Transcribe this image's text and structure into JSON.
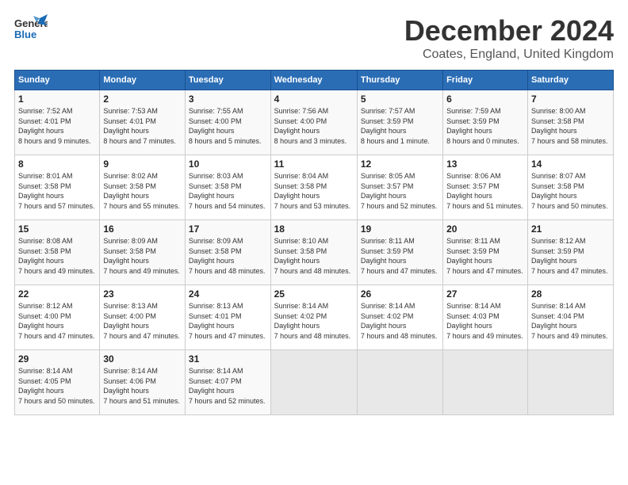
{
  "header": {
    "logo_general": "General",
    "logo_blue": "Blue",
    "month_title": "December 2024",
    "location": "Coates, England, United Kingdom"
  },
  "weekdays": [
    "Sunday",
    "Monday",
    "Tuesday",
    "Wednesday",
    "Thursday",
    "Friday",
    "Saturday"
  ],
  "weeks": [
    [
      {
        "day": "1",
        "sunrise": "7:52 AM",
        "sunset": "4:01 PM",
        "daylight": "8 hours and 9 minutes."
      },
      {
        "day": "2",
        "sunrise": "7:53 AM",
        "sunset": "4:01 PM",
        "daylight": "8 hours and 7 minutes."
      },
      {
        "day": "3",
        "sunrise": "7:55 AM",
        "sunset": "4:00 PM",
        "daylight": "8 hours and 5 minutes."
      },
      {
        "day": "4",
        "sunrise": "7:56 AM",
        "sunset": "4:00 PM",
        "daylight": "8 hours and 3 minutes."
      },
      {
        "day": "5",
        "sunrise": "7:57 AM",
        "sunset": "3:59 PM",
        "daylight": "8 hours and 1 minute."
      },
      {
        "day": "6",
        "sunrise": "7:59 AM",
        "sunset": "3:59 PM",
        "daylight": "8 hours and 0 minutes."
      },
      {
        "day": "7",
        "sunrise": "8:00 AM",
        "sunset": "3:58 PM",
        "daylight": "7 hours and 58 minutes."
      }
    ],
    [
      {
        "day": "8",
        "sunrise": "8:01 AM",
        "sunset": "3:58 PM",
        "daylight": "7 hours and 57 minutes."
      },
      {
        "day": "9",
        "sunrise": "8:02 AM",
        "sunset": "3:58 PM",
        "daylight": "7 hours and 55 minutes."
      },
      {
        "day": "10",
        "sunrise": "8:03 AM",
        "sunset": "3:58 PM",
        "daylight": "7 hours and 54 minutes."
      },
      {
        "day": "11",
        "sunrise": "8:04 AM",
        "sunset": "3:58 PM",
        "daylight": "7 hours and 53 minutes."
      },
      {
        "day": "12",
        "sunrise": "8:05 AM",
        "sunset": "3:57 PM",
        "daylight": "7 hours and 52 minutes."
      },
      {
        "day": "13",
        "sunrise": "8:06 AM",
        "sunset": "3:57 PM",
        "daylight": "7 hours and 51 minutes."
      },
      {
        "day": "14",
        "sunrise": "8:07 AM",
        "sunset": "3:58 PM",
        "daylight": "7 hours and 50 minutes."
      }
    ],
    [
      {
        "day": "15",
        "sunrise": "8:08 AM",
        "sunset": "3:58 PM",
        "daylight": "7 hours and 49 minutes."
      },
      {
        "day": "16",
        "sunrise": "8:09 AM",
        "sunset": "3:58 PM",
        "daylight": "7 hours and 49 minutes."
      },
      {
        "day": "17",
        "sunrise": "8:09 AM",
        "sunset": "3:58 PM",
        "daylight": "7 hours and 48 minutes."
      },
      {
        "day": "18",
        "sunrise": "8:10 AM",
        "sunset": "3:58 PM",
        "daylight": "7 hours and 48 minutes."
      },
      {
        "day": "19",
        "sunrise": "8:11 AM",
        "sunset": "3:59 PM",
        "daylight": "7 hours and 47 minutes."
      },
      {
        "day": "20",
        "sunrise": "8:11 AM",
        "sunset": "3:59 PM",
        "daylight": "7 hours and 47 minutes."
      },
      {
        "day": "21",
        "sunrise": "8:12 AM",
        "sunset": "3:59 PM",
        "daylight": "7 hours and 47 minutes."
      }
    ],
    [
      {
        "day": "22",
        "sunrise": "8:12 AM",
        "sunset": "4:00 PM",
        "daylight": "7 hours and 47 minutes."
      },
      {
        "day": "23",
        "sunrise": "8:13 AM",
        "sunset": "4:00 PM",
        "daylight": "7 hours and 47 minutes."
      },
      {
        "day": "24",
        "sunrise": "8:13 AM",
        "sunset": "4:01 PM",
        "daylight": "7 hours and 47 minutes."
      },
      {
        "day": "25",
        "sunrise": "8:14 AM",
        "sunset": "4:02 PM",
        "daylight": "7 hours and 48 minutes."
      },
      {
        "day": "26",
        "sunrise": "8:14 AM",
        "sunset": "4:02 PM",
        "daylight": "7 hours and 48 minutes."
      },
      {
        "day": "27",
        "sunrise": "8:14 AM",
        "sunset": "4:03 PM",
        "daylight": "7 hours and 49 minutes."
      },
      {
        "day": "28",
        "sunrise": "8:14 AM",
        "sunset": "4:04 PM",
        "daylight": "7 hours and 49 minutes."
      }
    ],
    [
      {
        "day": "29",
        "sunrise": "8:14 AM",
        "sunset": "4:05 PM",
        "daylight": "7 hours and 50 minutes."
      },
      {
        "day": "30",
        "sunrise": "8:14 AM",
        "sunset": "4:06 PM",
        "daylight": "7 hours and 51 minutes."
      },
      {
        "day": "31",
        "sunrise": "8:14 AM",
        "sunset": "4:07 PM",
        "daylight": "7 hours and 52 minutes."
      },
      null,
      null,
      null,
      null
    ]
  ],
  "labels": {
    "sunrise": "Sunrise: ",
    "sunset": "Sunset: ",
    "daylight": "Daylight hours"
  }
}
